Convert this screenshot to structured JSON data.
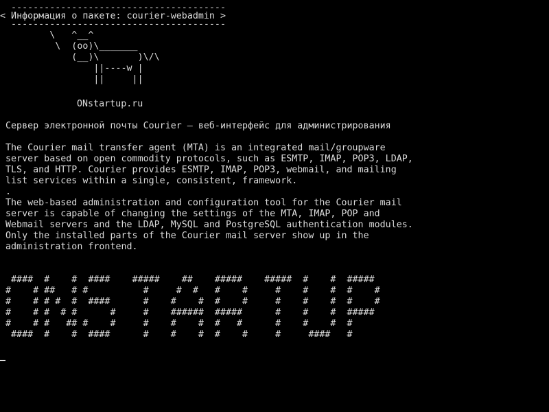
{
  "terminal": {
    "foreground": "#dcdcdc",
    "background": "#000000",
    "cowsay": {
      "border_top": " ---------------------------------------",
      "bubble": "< Информация о пакете: courier-webadmin >",
      "border_bottom": " ---------------------------------------",
      "art": [
        "        \\   ^__^",
        "         \\  (oo)\\_______",
        "            (__)\\       )\\/\\",
        "                ||----w |",
        "                ||     ||"
      ]
    },
    "site": "ONstartup.ru",
    "title": "Сервер электронной почты Courier — веб-интерфейс для администрирования",
    "paragraph1": [
      "The Courier mail transfer agent (MTA) is an integrated mail/groupware",
      "server based on open commodity protocols, such as ESMTP, IMAP, POP3, LDAP,",
      "TLS, and HTTP. Courier provides ESMTP, IMAP, POP3, webmail, and mailing",
      "list services within a single, consistent, framework."
    ],
    "separator": ".",
    "paragraph2": [
      "The web-based administration and configuration tool for the Courier mail",
      "server is capable of changing the settings of the MTA, IMAP, POP and",
      "Webmail servers and the LDAP, MySQL and PostgreSQL authentication modules.",
      "Only the installed parts of the Courier mail server show up in the",
      "administration frontend."
    ],
    "banner": [
      " ####  #    #  ####    #####    ##    #####    #####  #    #  #####",
      "#    # ##   # #          #     #  #   #    #     #    #    #  #    #",
      "#    # # #  #  ####      #    #    #  #    #     #    #    #  #    #",
      "#    # #  # #      #     #    ######  #####      #    #    #  #####",
      "#    # #   ## #    #     #    #    #  #   #      #    #    #  #",
      " ####  #    #  ####      #    #    #  #    #     #     ####   #"
    ]
  }
}
